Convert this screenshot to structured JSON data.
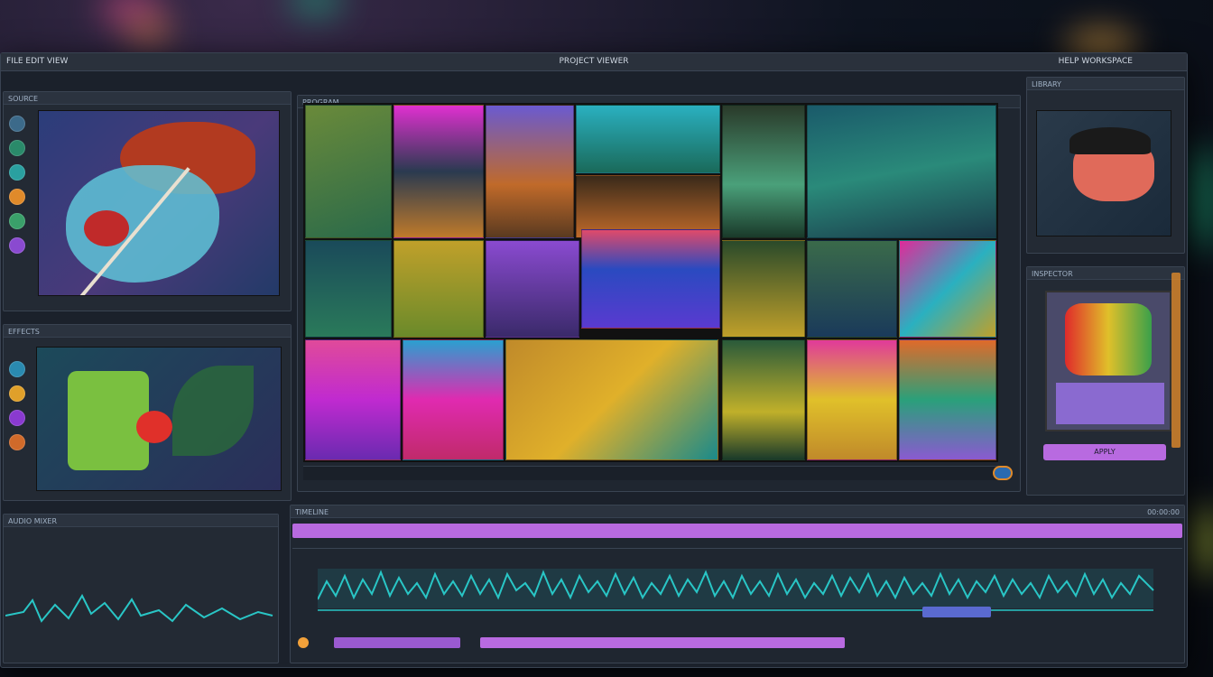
{
  "app": {
    "menu_left": "FILE  EDIT  VIEW",
    "window_title": "PROJECT VIEWER",
    "menu_right": "HELP  WORKSPACE"
  },
  "panels": {
    "source": {
      "title": "SOURCE"
    },
    "effects": {
      "title": "EFFECTS"
    },
    "audio": {
      "title": "AUDIO MIXER"
    },
    "program": {
      "title": "PROGRAM"
    },
    "library": {
      "title": "LIBRARY"
    },
    "inspector": {
      "title": "INSPECTOR",
      "button_label": "APPLY"
    },
    "timeline": {
      "title": "TIMELINE",
      "timecode": "00:00:00"
    }
  },
  "colors": {
    "accent_purple": "#b86ae0",
    "waveform": "#29c6c6",
    "accent_orange": "#f2a13a"
  },
  "tools": [
    "brush-icon",
    "palette-icon",
    "layers-icon",
    "orange-dot-icon",
    "purple-dot-icon",
    "cyan-dot-icon"
  ]
}
